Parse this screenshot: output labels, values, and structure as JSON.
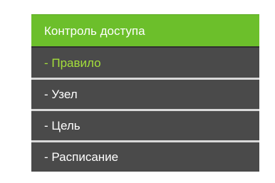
{
  "menu": {
    "header": "Контроль доступа",
    "items": [
      {
        "label": "- Правило",
        "active": true
      },
      {
        "label": "- Узел",
        "active": false
      },
      {
        "label": "- Цель",
        "active": false
      },
      {
        "label": "- Расписание",
        "active": false
      }
    ]
  },
  "colors": {
    "header_bg": "#6cbf2b",
    "item_bg": "#4a4a4a",
    "active_text": "#a4df3b",
    "separator": "#d9d9d9"
  }
}
